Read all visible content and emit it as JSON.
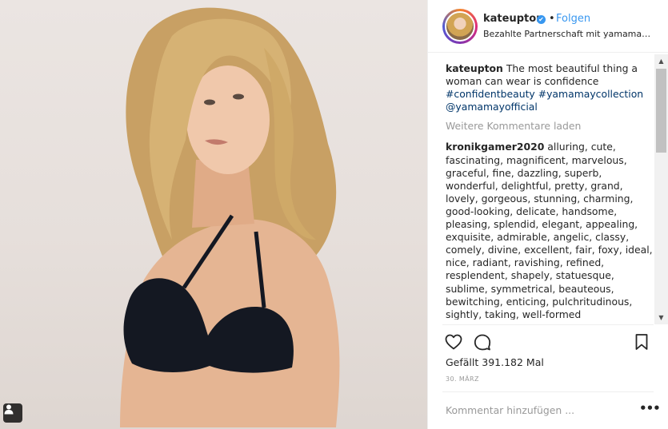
{
  "post": {
    "author": "kateupton",
    "verified_glyph": "✔",
    "separator": "•",
    "follow_label": "Folgen",
    "subtitle": "Bezahlte Partnerschaft mit yamamayof..."
  },
  "caption": {
    "username": "kateupton",
    "text": "The most beautiful thing a woman can wear is confidence",
    "tags": [
      "#confidentbeauty",
      "#yamamaycollection",
      "@yamamayofficial"
    ]
  },
  "load_more_label": "Weitere Kommentare laden",
  "comment": {
    "username": "kronikgamer2020",
    "text": "alluring, cute, fascinating, magnificent, marvelous, graceful, fine, dazzling, superb, wonderful, delightful, pretty, grand, lovely, gorgeous, stunning, charming, good-looking, delicate, handsome, pleasing, splendid, elegant, appealing, exquisite, admirable, angelic, classy, comely, divine, excellent, fair, foxy, ideal, nice, radiant, ravishing, refined, resplendent, shapely, statuesque, sublime, symmetrical, beauteous, bewitching, enticing, pulchritudinous, sightly, taking, well-formed"
  },
  "likes_text": "Gefällt 391.182 Mal",
  "date_text": "30. MÄRZ",
  "comment_input": {
    "placeholder": "Kommentar hinzufügen ...",
    "value": ""
  },
  "more_options_label": "•••",
  "scroll_arrows": {
    "up": "▲",
    "down": "▼"
  },
  "icons": {
    "like": "heart-icon",
    "comment": "speech-bubble-icon",
    "save": "bookmark-icon",
    "user_tags": "person-icon"
  },
  "colors": {
    "link": "#3897f0",
    "hashtag": "#003569",
    "muted": "#999999",
    "text": "#262626",
    "verified": "#3897f0"
  }
}
